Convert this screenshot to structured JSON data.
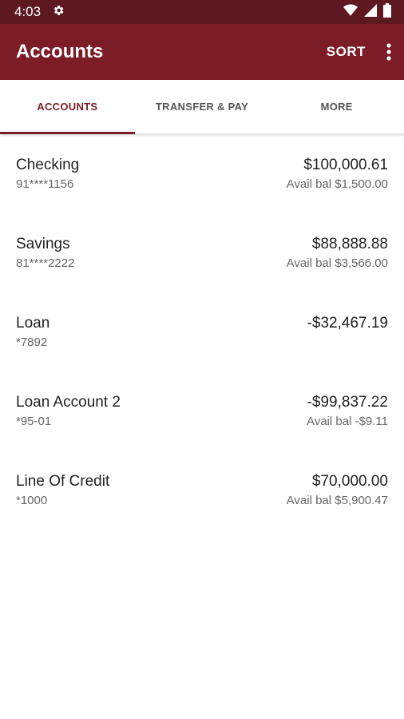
{
  "status_bar": {
    "time": "4:03",
    "icons": [
      "settings-icon",
      "wifi-icon",
      "signal-icon",
      "battery-icon"
    ]
  },
  "app_bar": {
    "title": "Accounts",
    "sort_label": "SORT",
    "overflow_icon": "more-vert-icon"
  },
  "tabs": [
    {
      "label": "ACCOUNTS",
      "active": true
    },
    {
      "label": "TRANSFER & PAY",
      "active": false
    },
    {
      "label": "MORE",
      "active": false
    }
  ],
  "accounts": [
    {
      "name": "Checking",
      "number": "91****1156",
      "balance": "$100,000.61",
      "avail": "Avail bal $1,500.00"
    },
    {
      "name": "Savings",
      "number": "81****2222",
      "balance": "$88,888.88",
      "avail": "Avail bal $3,566.00"
    },
    {
      "name": "Loan",
      "number": "*7892",
      "balance": "-$32,467.19",
      "avail": ""
    },
    {
      "name": "Loan Account 2",
      "number": "*95-01",
      "balance": "-$99,837.22",
      "avail": "Avail bal -$9.11"
    },
    {
      "name": "Line Of Credit",
      "number": "*1000",
      "balance": "$70,000.00",
      "avail": "Avail bal $5,900.47"
    }
  ],
  "colors": {
    "status_bar": "#5e1820",
    "app_bar": "#7b1c26",
    "accent": "#7b1c26"
  }
}
